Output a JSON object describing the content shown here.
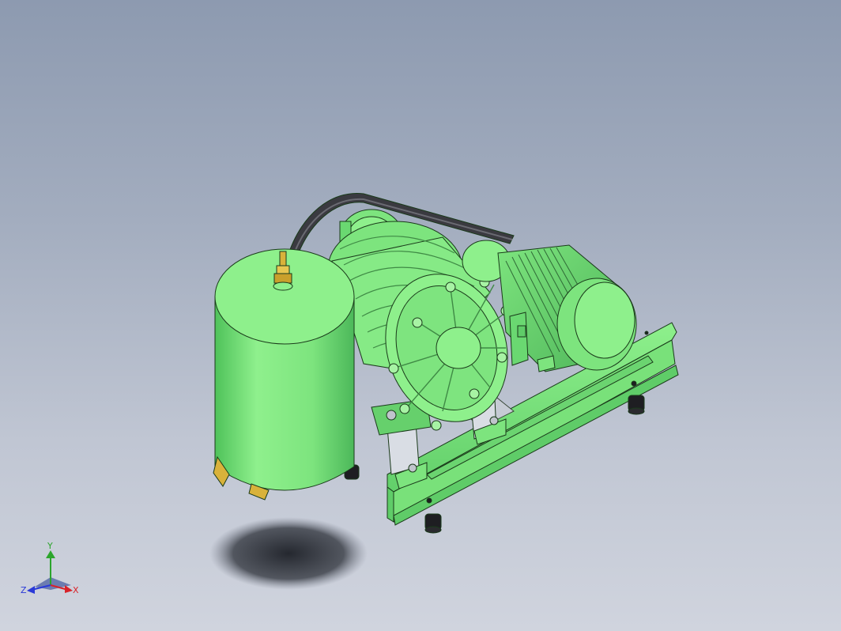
{
  "viewport": {
    "background_top": "#8d9ab0",
    "background_bottom": "#d0d4de"
  },
  "model": {
    "body_color": "#8ef08c",
    "body_shade": "#5ed06a",
    "belt_color": "#3a3a40",
    "fitting_color": "#d9b23a",
    "foot_color": "#1e1e22"
  },
  "triad": {
    "x_label": "X",
    "y_label": "Y",
    "z_label": "Z",
    "x_color": "#d8232a",
    "y_color": "#2ca52c",
    "z_color": "#2a3ad8"
  }
}
